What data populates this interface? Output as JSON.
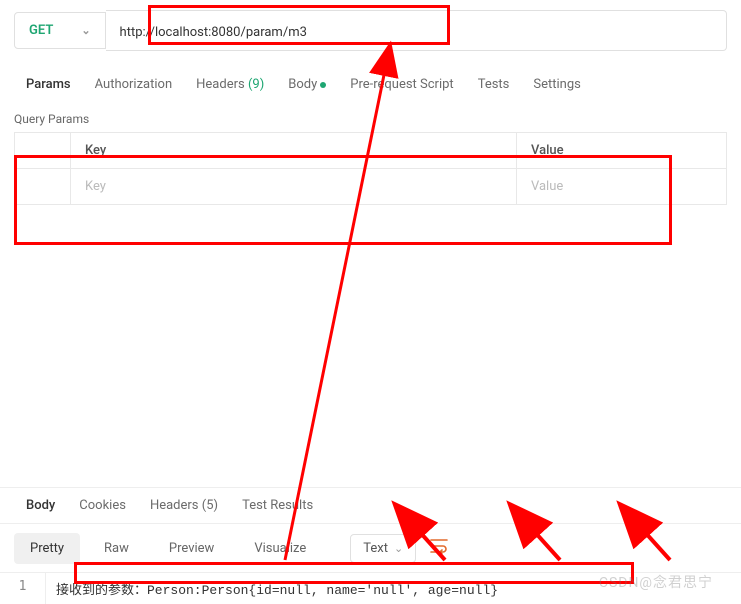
{
  "request": {
    "method": "GET",
    "url": "http://localhost:8080/param/m3"
  },
  "tabs": {
    "params": "Params",
    "authorization": "Authorization",
    "headers": "Headers",
    "headers_count": "(9)",
    "body": "Body",
    "prerequest": "Pre-request Script",
    "tests": "Tests",
    "settings": "Settings"
  },
  "query_params": {
    "section_label": "Query Params",
    "key_header": "Key",
    "value_header": "Value",
    "key_placeholder": "Key",
    "value_placeholder": "Value"
  },
  "response": {
    "tabs": {
      "body": "Body",
      "cookies": "Cookies",
      "headers": "Headers",
      "headers_count": "(5)",
      "test_results": "Test Results"
    },
    "views": {
      "pretty": "Pretty",
      "raw": "Raw",
      "preview": "Preview",
      "visualize": "Visualize"
    },
    "type": "Text",
    "line_no": "1",
    "content": "接收到的参数：Person:Person{id=null, name='null', age=null}"
  },
  "watermark": "CSDN@念君思宁"
}
